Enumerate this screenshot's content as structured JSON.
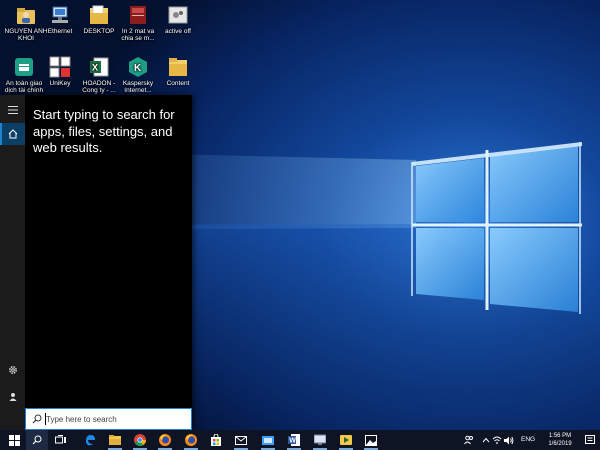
{
  "desktop": {
    "icons": [
      {
        "label": "NGUYEN ANH KHOI",
        "icon": "user-folder-icon"
      },
      {
        "label": "Ethernet",
        "icon": "network-icon"
      },
      {
        "label": "DESKTOP",
        "icon": "folder-icon"
      },
      {
        "label": "In 2 mat va chia se m...",
        "icon": "book-icon"
      },
      {
        "label": "active off",
        "icon": "shortcut-icon"
      },
      {
        "label": "An toàn giao dịch tài chính",
        "icon": "kaspersky-safe-money-icon"
      },
      {
        "label": "UniKey",
        "icon": "unikey-icon"
      },
      {
        "label": "HOADON - Cong ty - ...",
        "icon": "excel-icon"
      },
      {
        "label": "Kaspersky Internet...",
        "icon": "kaspersky-icon"
      },
      {
        "label": "Content",
        "icon": "folder-icon"
      }
    ]
  },
  "start_menu": {
    "search_hint": "Start typing to search for apps, files, settings, and web results.",
    "rail": {
      "menu_icon": "hamburger-icon",
      "home_icon": "home-icon",
      "settings_icon": "gear-icon",
      "power_icon": "power-icon"
    }
  },
  "search": {
    "placeholder": "Type here to search"
  },
  "taskbar": {
    "pinned": [
      "file-explorer-icon",
      "chrome-icon",
      "firefox-icon",
      "firefox-icon",
      "mail-icon",
      "store-icon"
    ],
    "tray": {
      "language": "ENG",
      "time": "1:56 PM",
      "date": "1/6/2019"
    }
  }
}
